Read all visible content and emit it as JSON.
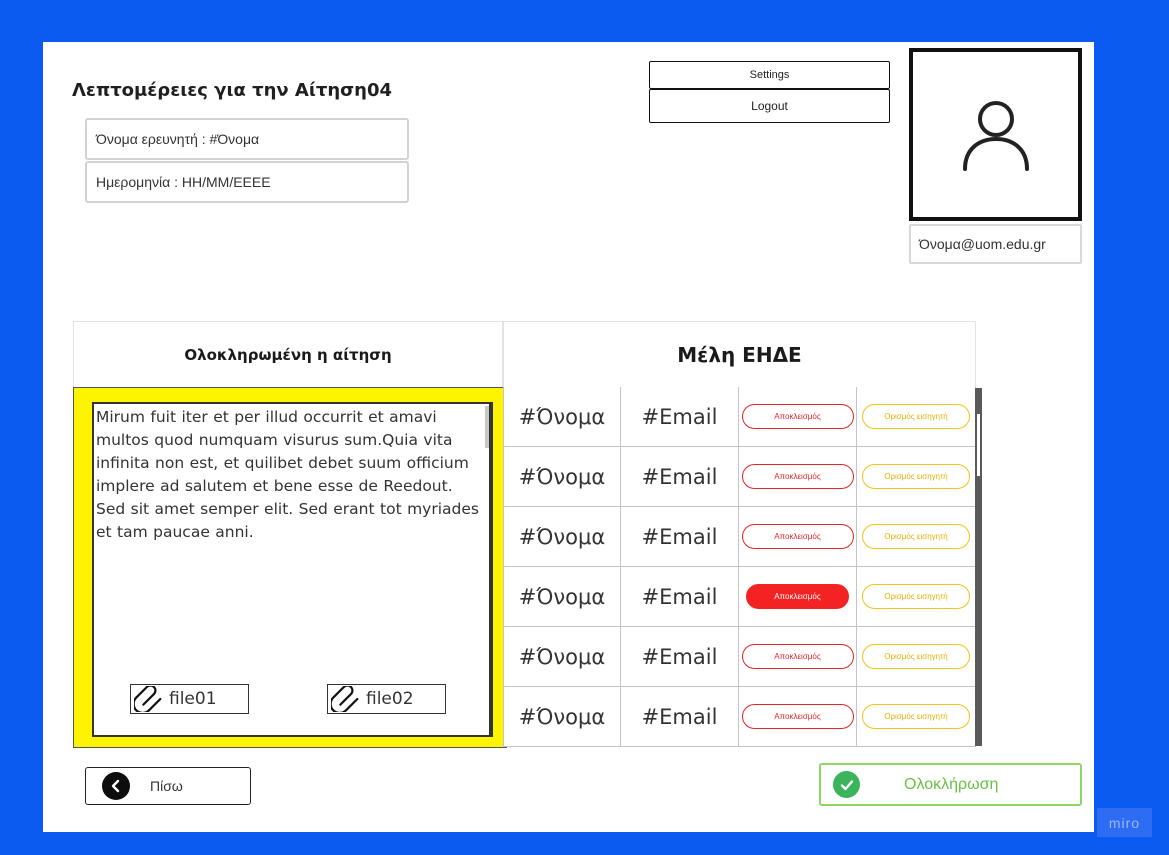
{
  "header": {
    "title": "Λεπτομέρειες για την Αίτηση04",
    "researcher": "Όνομα ερευνητή : #Όνομα",
    "date": "Ημερομηνία : ΗΗ/ΜΜ/ΕΕΕΕ"
  },
  "account": {
    "settings_label": "Settings",
    "logout_label": "Logout",
    "email": "Όνομα@uom.edu.gr",
    "avatar_icon": "user-icon"
  },
  "application": {
    "heading": "Ολοκληρωμένη η αίτηση",
    "text": "Mirum fuit iter et per illud occurrit et amavi multos quod numquam visurus sum.Quia vita infinita non est, et quilibet debet suum officium implere ad salutem et bene esse de Reedout. Sed sit amet semper elit. Sed erant tot myriades et tam paucae anni.",
    "files": [
      {
        "name": "file01",
        "icon": "paperclip-icon"
      },
      {
        "name": "file02",
        "icon": "paperclip-icon"
      }
    ]
  },
  "members": {
    "heading": "Μέλη ΕΗΔΕ",
    "rows": [
      {
        "name": "#Όνομα",
        "email": "#Email",
        "exclude_label": "Αποκλεισμός",
        "exclude_active": false,
        "assign_label": "Ορισμός εισηγητή"
      },
      {
        "name": "#Όνομα",
        "email": "#Email",
        "exclude_label": "Αποκλεισμός",
        "exclude_active": false,
        "assign_label": "Ορισμός εισηγητή"
      },
      {
        "name": "#Όνομα",
        "email": "#Email",
        "exclude_label": "Αποκλεισμός",
        "exclude_active": false,
        "assign_label": "Ορισμός εισηγητή"
      },
      {
        "name": "#Όνομα",
        "email": "#Email",
        "exclude_label": "Αποκλεισμός",
        "exclude_active": true,
        "assign_label": "Ορισμός εισηγητή"
      },
      {
        "name": "#Όνομα",
        "email": "#Email",
        "exclude_label": "Αποκλεισμός",
        "exclude_active": false,
        "assign_label": "Ορισμός εισηγητή"
      },
      {
        "name": "#Όνομα",
        "email": "#Email",
        "exclude_label": "Αποκλεισμός",
        "exclude_active": false,
        "assign_label": "Ορισμός εισηγητή"
      }
    ]
  },
  "footer": {
    "back_label": "Πίσω",
    "back_icon": "chevron-left-icon",
    "finish_label": "Ολοκλήρωση",
    "finish_icon": "check-icon"
  },
  "watermark": "miro",
  "colors": {
    "background": "#0b5bf0",
    "highlight": "#fef400",
    "danger": "#f42323",
    "warning": "#f2c419",
    "success": "#3bb45b"
  }
}
